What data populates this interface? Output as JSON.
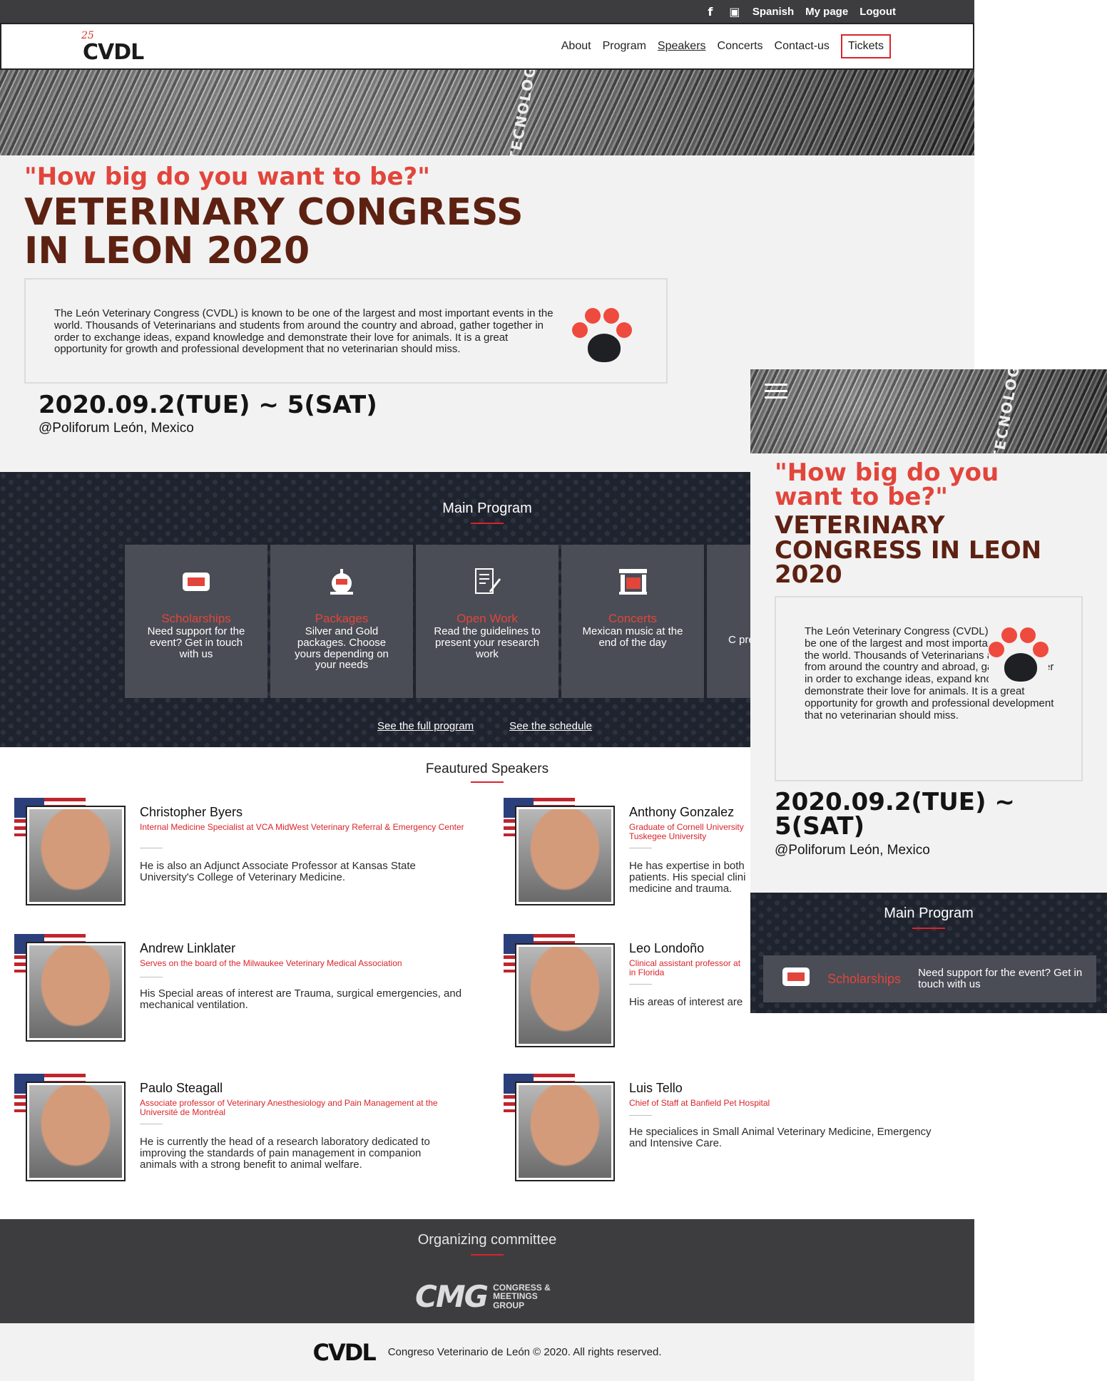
{
  "topbar": {
    "facebook_icon": "f",
    "language": "Spanish",
    "my_page": "My page",
    "logout": "Logout"
  },
  "logo": {
    "anniversary": "25",
    "name": "CVDL"
  },
  "nav": {
    "about": "About",
    "program": "Program",
    "speakers": "Speakers",
    "concerts": "Concerts",
    "contact": "Contact-us",
    "tickets": "Tickets"
  },
  "hero": {
    "banner_sign": "TECNOLOGÍ",
    "slogan": "\"How big do you want to be?\"",
    "title_line1": "VETERINARY CONGRESS",
    "title_line2": "IN LEON 2020",
    "intro": "The León Veterinary Congress (CVDL) is known to be one of the largest and most important events in the world. Thousands of Veterinarians and students from around the country and abroad, gather together in order to exchange ideas, expand knowledge and demonstrate their love for animals. It is a great opportunity for growth and professional development that no veterinarian should miss.",
    "date": "2020.09.2(TUE) ~ 5(SAT)",
    "venue": "@Poliforum León, Mexico"
  },
  "program": {
    "title": "Main Program",
    "cards": [
      {
        "icon": "ticket-icon",
        "title": "Scholarships",
        "desc": "Need support for the event? Get in touch with us"
      },
      {
        "icon": "gift-icon",
        "title": "Packages",
        "desc": "Silver and Gold packages. Choose yours depending on your needs"
      },
      {
        "icon": "document-edit-icon",
        "title": "Open Work",
        "desc": "Read the guidelines to present your research work"
      },
      {
        "icon": "stage-icon",
        "title": "Concerts",
        "desc": "Mexican music at the end of the day"
      }
    ],
    "partial_card_text": "C pre",
    "link_full_program": "See the full program",
    "link_schedule": "See the schedule"
  },
  "speakers": {
    "title": "Feautured Speakers",
    "items": [
      {
        "name": "Christopher Byers",
        "role": "Internal Medicine Specialist at VCA MidWest Veterinary Referral & Emergency Center",
        "bio": "He is also an Adjunct Associate Professor at Kansas State University's College of Veterinary Medicine."
      },
      {
        "name": "Anthony Gonzalez",
        "role": "Graduate of Cornell University Tuskegee University",
        "bio": "He has expertise in both patients. His special clini medicine and trauma."
      },
      {
        "name": "Andrew Linklater",
        "role": "Serves on the board of the Milwaukee Veterinary Medical Association",
        "bio": "His Special areas of interest are Trauma, surgical emergencies, and mechanical ventilation."
      },
      {
        "name": "Leo Londoño",
        "role": "Clinical assistant professor at in Florida",
        "bio": "His areas of interest are"
      },
      {
        "name": "Paulo Steagall",
        "role": "Associate professor of Veterinary Anesthesiology and Pain Management at the Université de Montréal",
        "bio": "He is currently the head of a research laboratory dedicated to improving the standards of pain management in companion animals with a strong benefit to animal welfare."
      },
      {
        "name": "Luis Tello",
        "role": "Chief of Staff at Banfield Pet Hospital",
        "bio": "He specialices in Small Animal Veterinary Medicine, Emergency and Intensive Care."
      }
    ]
  },
  "committee": {
    "title": "Organizing committee",
    "logo_big": "CMG",
    "logo_small_1": "CONGRESS &",
    "logo_small_2": "MEETINGS",
    "logo_small_3": "GROUP"
  },
  "footer": {
    "logo": "CVDL",
    "copyright": "Congreso Veterinario de León © 2020. All rights reserved."
  },
  "mobile": {
    "slogan": "\"How big do you want to be?\"",
    "title": "VETERINARY CONGRESS IN LEON 2020",
    "intro": "The León Veterinary Congress (CVDL) is known to be one of the largest and most important events in the world. Thousands of Veterinarians and students from around the country and abroad, gather together in order to exchange ideas, expand knowledge and demonstrate their love for animals. It is a great opportunity for growth and professional development that no veterinarian should miss.",
    "date": "2020.09.2(TUE) ~ 5(SAT)",
    "venue": "@Poliforum León, Mexico",
    "program_title": "Main Program",
    "card_title": "Scholarships",
    "card_desc": "Need support for the event? Get in touch with us"
  },
  "colors": {
    "accent": "#d9242a",
    "title": "#5d2112",
    "slogan": "#e2453b",
    "dark": "#3d3d3f"
  }
}
